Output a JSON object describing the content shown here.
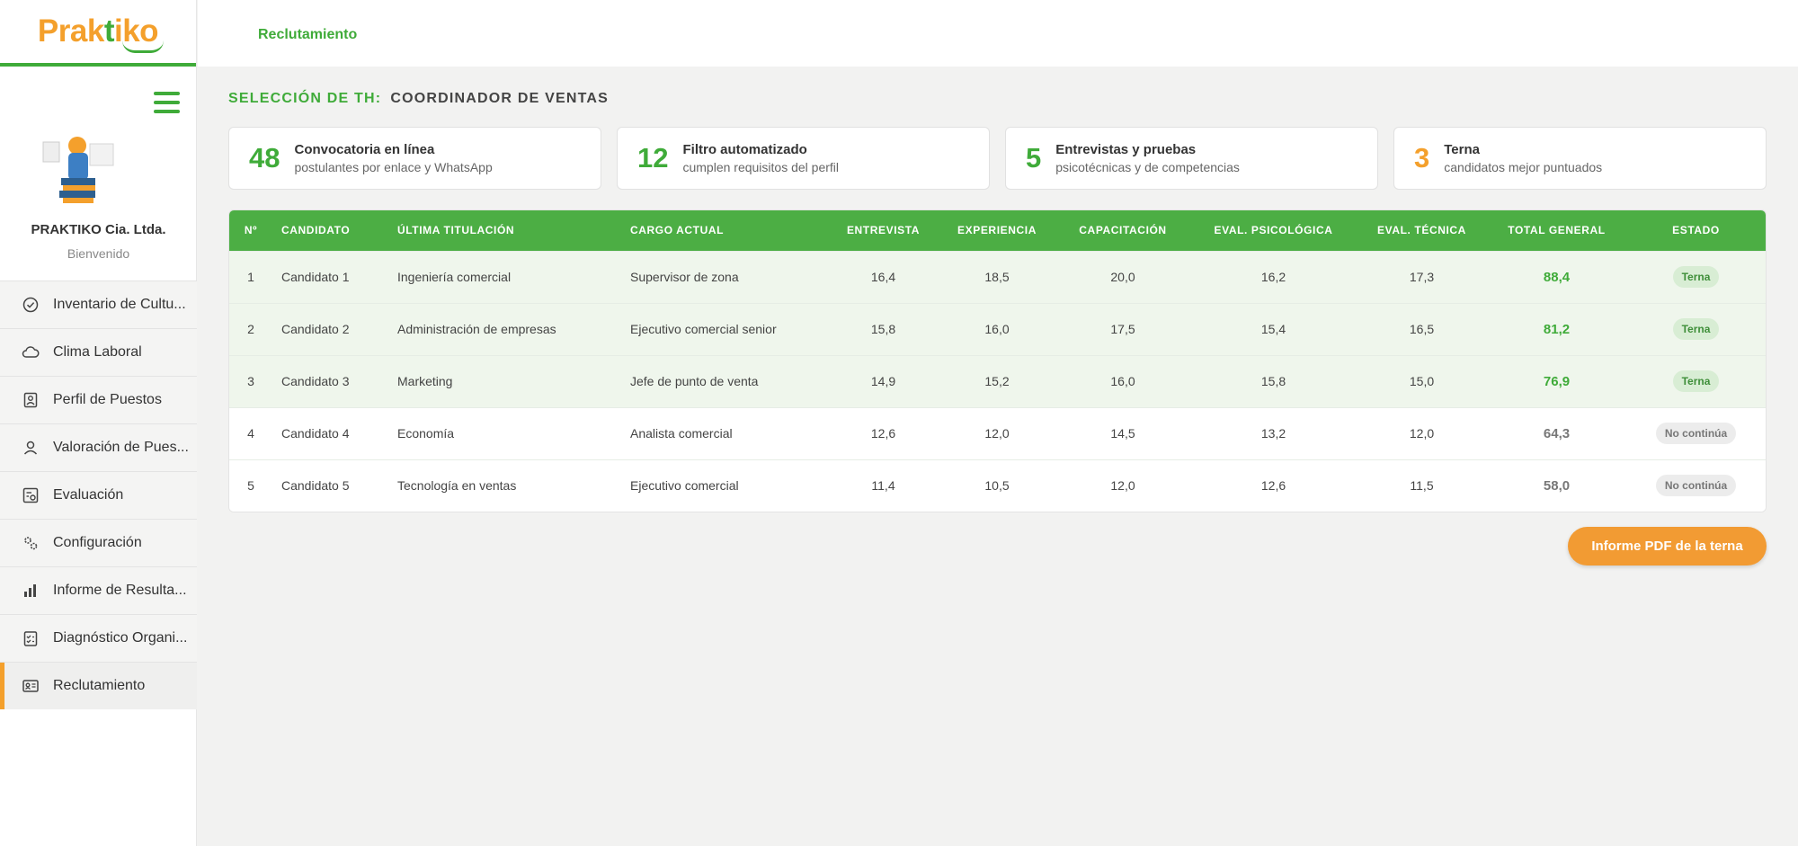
{
  "brand": {
    "name": "Praktiko",
    "name_start": "Prak",
    "name_accent": "t",
    "name_end": "iko"
  },
  "sidebar": {
    "company": "PRAKTIKO Cia. Ltda.",
    "welcome": "Bienvenido",
    "items": [
      {
        "label": "Inventario de Cultu...",
        "icon": "check-circle-icon"
      },
      {
        "label": "Clima Laboral",
        "icon": "cloud-icon"
      },
      {
        "label": "Perfil de Puestos",
        "icon": "id-badge-icon"
      },
      {
        "label": "Valoración de Pues...",
        "icon": "user-icon"
      },
      {
        "label": "Evaluación",
        "icon": "evaluation-icon"
      },
      {
        "label": "Configuración",
        "icon": "gears-icon"
      },
      {
        "label": "Informe de Resulta...",
        "icon": "bar-chart-icon"
      },
      {
        "label": "Diagnóstico Organi...",
        "icon": "checklist-icon"
      },
      {
        "label": "Reclutamiento",
        "icon": "id-card-icon"
      }
    ]
  },
  "header": {
    "breadcrumb": "Reclutamiento"
  },
  "section": {
    "label": "SELECCIÓN DE TH:",
    "value": "COORDINADOR DE VENTAS"
  },
  "stats": [
    {
      "number": "48",
      "title": "Convocatoria en línea",
      "subtitle": "postulantes por enlace y WhatsApp"
    },
    {
      "number": "12",
      "title": "Filtro automatizado",
      "subtitle": "cumplen requisitos del perfil"
    },
    {
      "number": "5",
      "title": "Entrevistas y pruebas",
      "subtitle": "psicotécnicas y de competencias"
    },
    {
      "number": "3",
      "title": "Terna",
      "subtitle": "candidatos mejor puntuados"
    }
  ],
  "table": {
    "headers": [
      "Nº",
      "CANDIDATO",
      "ÚLTIMA TITULACIÓN",
      "CARGO ACTUAL",
      "ENTREVISTA",
      "EXPERIENCIA",
      "CAPACITACIÓN",
      "EVAL. PSICOLÓGICA",
      "EVAL. TÉCNICA",
      "TOTAL GENERAL",
      "ESTADO"
    ],
    "rows": [
      {
        "n": "1",
        "candidato": "Candidato 1",
        "titulacion": "Ingeniería comercial",
        "cargo": "Supervisor de zona",
        "entrevista": "16,4",
        "experiencia": "18,5",
        "capacitacion": "20,0",
        "psicologica": "16,2",
        "tecnica": "17,3",
        "total": "88,4",
        "estado": "Terna"
      },
      {
        "n": "2",
        "candidato": "Candidato 2",
        "titulacion": "Administración de empresas",
        "cargo": "Ejecutivo comercial senior",
        "entrevista": "15,8",
        "experiencia": "16,0",
        "capacitacion": "17,5",
        "psicologica": "15,4",
        "tecnica": "16,5",
        "total": "81,2",
        "estado": "Terna"
      },
      {
        "n": "3",
        "candidato": "Candidato 3",
        "titulacion": "Marketing",
        "cargo": "Jefe de punto de venta",
        "entrevista": "14,9",
        "experiencia": "15,2",
        "capacitacion": "16,0",
        "psicologica": "15,8",
        "tecnica": "15,0",
        "total": "76,9",
        "estado": "Terna"
      },
      {
        "n": "4",
        "candidato": "Candidato 4",
        "titulacion": "Economía",
        "cargo": "Analista comercial",
        "entrevista": "12,6",
        "experiencia": "12,0",
        "capacitacion": "14,5",
        "psicologica": "13,2",
        "tecnica": "12,0",
        "total": "64,3",
        "estado": "No continúa"
      },
      {
        "n": "5",
        "candidato": "Candidato 5",
        "titulacion": "Tecnología en ventas",
        "cargo": "Ejecutivo comercial",
        "entrevista": "11,4",
        "experiencia": "10,5",
        "capacitacion": "12,0",
        "psicologica": "12,6",
        "tecnica": "11,5",
        "total": "58,0",
        "estado": "No continúa"
      }
    ]
  },
  "actions": {
    "pdf_label": "Informe PDF de la terna"
  },
  "colors": {
    "green": "#3fab39",
    "orange": "#f4a02c",
    "header_green": "#4cae44"
  }
}
